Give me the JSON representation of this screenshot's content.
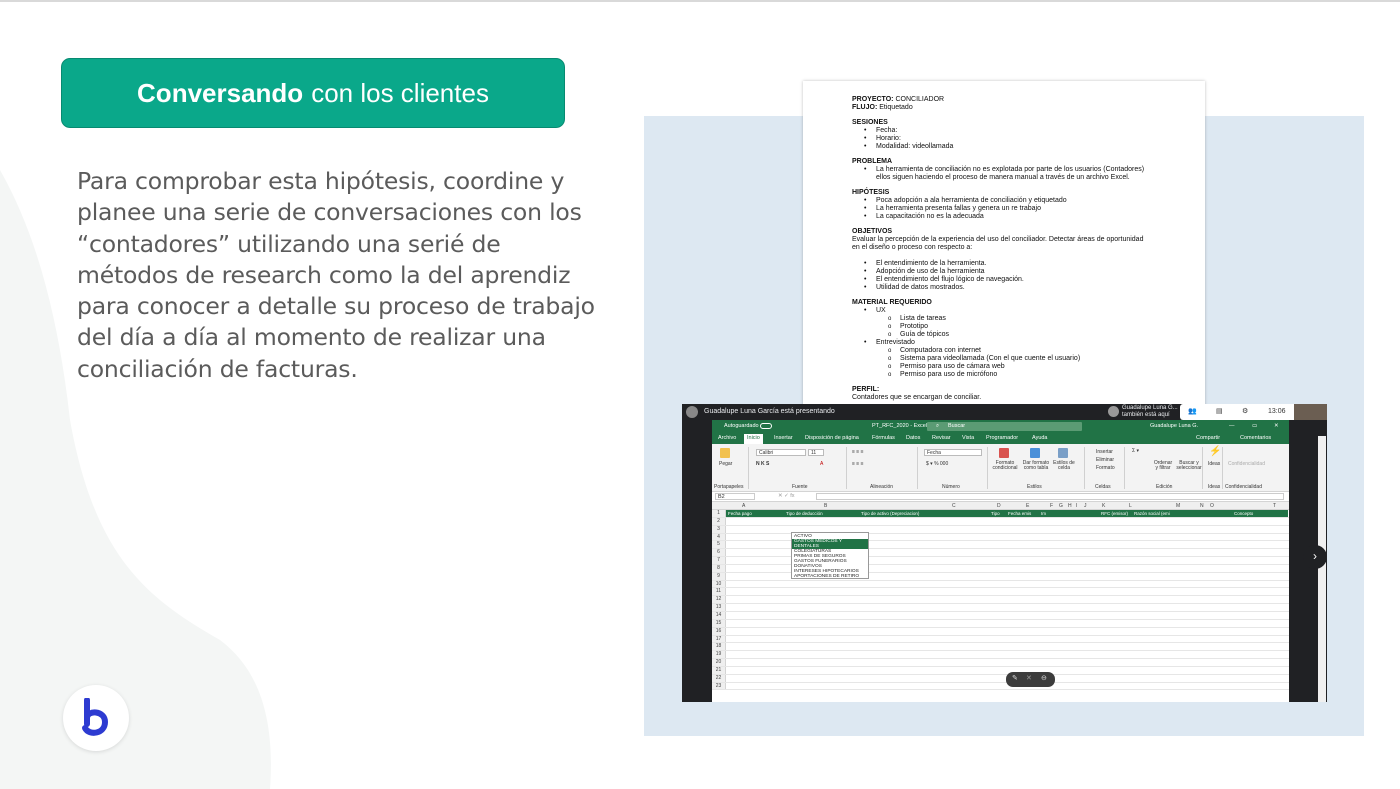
{
  "slide": {
    "title_bold": "Conversando",
    "title_rest": "con los clientes",
    "body": "Para comprobar esta hipótesis, coordine y planee una serie de conversaciones con los “contadores”  utilizando una serié de métodos de research como la del aprendiz para conocer a detalle su proceso de trabajo del día a día al momento de realizar una conciliación de facturas.",
    "colors": {
      "accent": "#0aa88a",
      "panel": "#dde8f2",
      "text": "#5b5b5b"
    }
  },
  "doc": {
    "proyecto_label": "PROYECTO:",
    "proyecto_value": "CONCILIADOR",
    "flujo_label": "FLUJO:",
    "flujo_value": "Etiquetado",
    "sesiones_title": "SESIONES",
    "sesiones": [
      "Fecha:",
      "Horario:",
      "Modalidad: videollamada"
    ],
    "problema_title": "PROBLEMA",
    "problema": "La herramienta de conciliación no es explotada por parte de los usuarios (Contadores) ellos siguen haciendo el proceso de manera manual a través de un archivo Excel.",
    "hipotesis_title": "HIPÓTESIS",
    "hipotesis": [
      "Poca adopción a ala herramienta de conciliación y etiquetado",
      "La herramienta presenta fallas y genera un re trabajo",
      "La capacitación no es la adecuada"
    ],
    "objetivos_title": "OBJETIVOS",
    "objetivos_intro": "Evaluar la percepción de la experiencia del uso del conciliador. Detectar áreas de oportunidad en el diseño  o proceso con respecto a:",
    "objetivos": [
      "El entendimiento de la herramienta.",
      "Adopción de uso de la herramienta",
      "El entendimiento del flujo lógico de navegación.",
      "Utilidad de datos mostrados."
    ],
    "material_title": "MATERIAL REQUERIDO",
    "material_ux": "UX",
    "material_ux_items": [
      "Lista de tareas",
      "Prototipo",
      "Guía de tópicos"
    ],
    "material_ent": "Entrevistado",
    "material_ent_items": [
      "Computadora con internet",
      "Sistema para videollamada (Con el que cuente el usuario)",
      "Permiso para uso de cámara web",
      "Permiso para uso de micrófono"
    ],
    "perfil_title": "PERFIL:",
    "perfil": "Contadores que se encargan de conciliar."
  },
  "meet": {
    "presenting": "Guadalupe Luna García está presentando",
    "user_line1": "Guadalupe Luna G...",
    "user_line2": "también está aquí",
    "time": "13:06",
    "next_icon": "chevron-right-icon"
  },
  "excel": {
    "autosave": "Autoguardado",
    "filename": "PT_RFC_2020  -  Excel",
    "search_placeholder": "Buscar",
    "user": "Guadalupe Luna G.",
    "menu": [
      "Archivo",
      "Inicio",
      "Insertar",
      "Disposición de página",
      "Fórmulas",
      "Datos",
      "Revisar",
      "Vista",
      "Programador",
      "Ayuda"
    ],
    "share": "Compartir",
    "comments": "Comentarios",
    "font": "Calibri",
    "font_size": "11",
    "number_format": "Fecha",
    "groups": [
      "Portapapeles",
      "Fuente",
      "Alineación",
      "Número",
      "Estilos",
      "Celdas",
      "Edición",
      "Ideas",
      "Confidencialidad"
    ],
    "paste": "Pegar",
    "cond_format": "Formato condicional",
    "table_format": "Dar formato como tabla",
    "cell_styles": "Estilos de celda",
    "insert": "Insertar",
    "delete": "Eliminar",
    "format": "Formato",
    "sort": "Ordenar y filtrar",
    "find": "Buscar y seleccionar",
    "ideas": "Ideas",
    "confidentiality": "Confidencialidad",
    "cell_ref": "B2",
    "columns": [
      "A",
      "B",
      "C",
      "D",
      "E",
      "F",
      "G",
      "H",
      "I",
      "J",
      "K",
      "L",
      "M",
      "N",
      "O",
      "T"
    ],
    "table_headers": [
      "Fecha pago",
      "Tipo de deducción",
      "Tipo de activo (Depreciacion)",
      "Tipo",
      "Fecha emis",
      "Im",
      "RFC (emisor)",
      "Razón social (emi",
      "Concepto"
    ],
    "dropdown": [
      "ACTIVO",
      "GASTOS MEDICOS Y DENTALES",
      "COLEGIATURAS",
      "PRIMAS DE SEGUROS",
      "GASTOS FUNERARIOS",
      "DONATIVOS",
      "INTERESES HIPOTECARIOS",
      "APORTACIONES DE RETIRO"
    ],
    "rows": [
      "1",
      "2",
      "3",
      "4",
      "5",
      "6",
      "7",
      "8",
      "9",
      "10",
      "11",
      "12",
      "13",
      "14",
      "15",
      "16",
      "17",
      "18",
      "19",
      "20",
      "21",
      "22",
      "23"
    ]
  }
}
